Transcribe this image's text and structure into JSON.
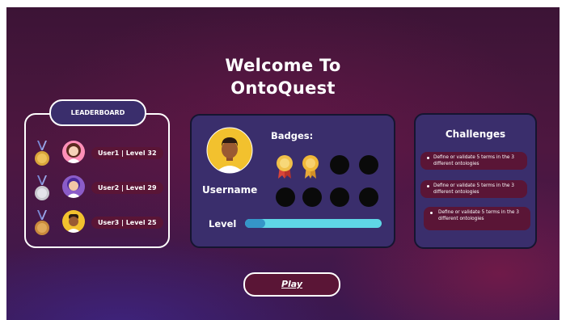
{
  "header": {
    "title_line1": "Welcome To",
    "title_line2": "OntoQuest"
  },
  "leaderboard": {
    "label": "LEADERBOARD",
    "entries": [
      {
        "text": "User1 | Level 32",
        "medal": "gold-medal-icon",
        "medal_color": "#d9a53a"
      },
      {
        "text": "User2 | Level 29",
        "medal": "silver-medal-icon",
        "medal_color": "#c9c9cf"
      },
      {
        "text": "User3 | Level 25",
        "medal": "bronze-medal-icon",
        "medal_color": "#c98a3c"
      }
    ]
  },
  "profile": {
    "username": "Username",
    "badges_label": "Badges:",
    "badges_earned": 2,
    "badges_total": 8,
    "level_label": "Level",
    "level_progress": 0.15
  },
  "challenges": {
    "title": "Challenges",
    "items": [
      "Define or validate 5 terms in the 3 different ontologies",
      "Define or validate 5 terms in the 3 different ontologies",
      "Define or validate 5 terms in the 3 different ontologies"
    ]
  },
  "actions": {
    "play_label": "Play"
  },
  "colors": {
    "panel": "#3a2e6c",
    "pill": "#5a1536",
    "level_track": "#5fd6e6",
    "level_fill": "#3596c8",
    "avatar_bg": "#f2c12e"
  }
}
